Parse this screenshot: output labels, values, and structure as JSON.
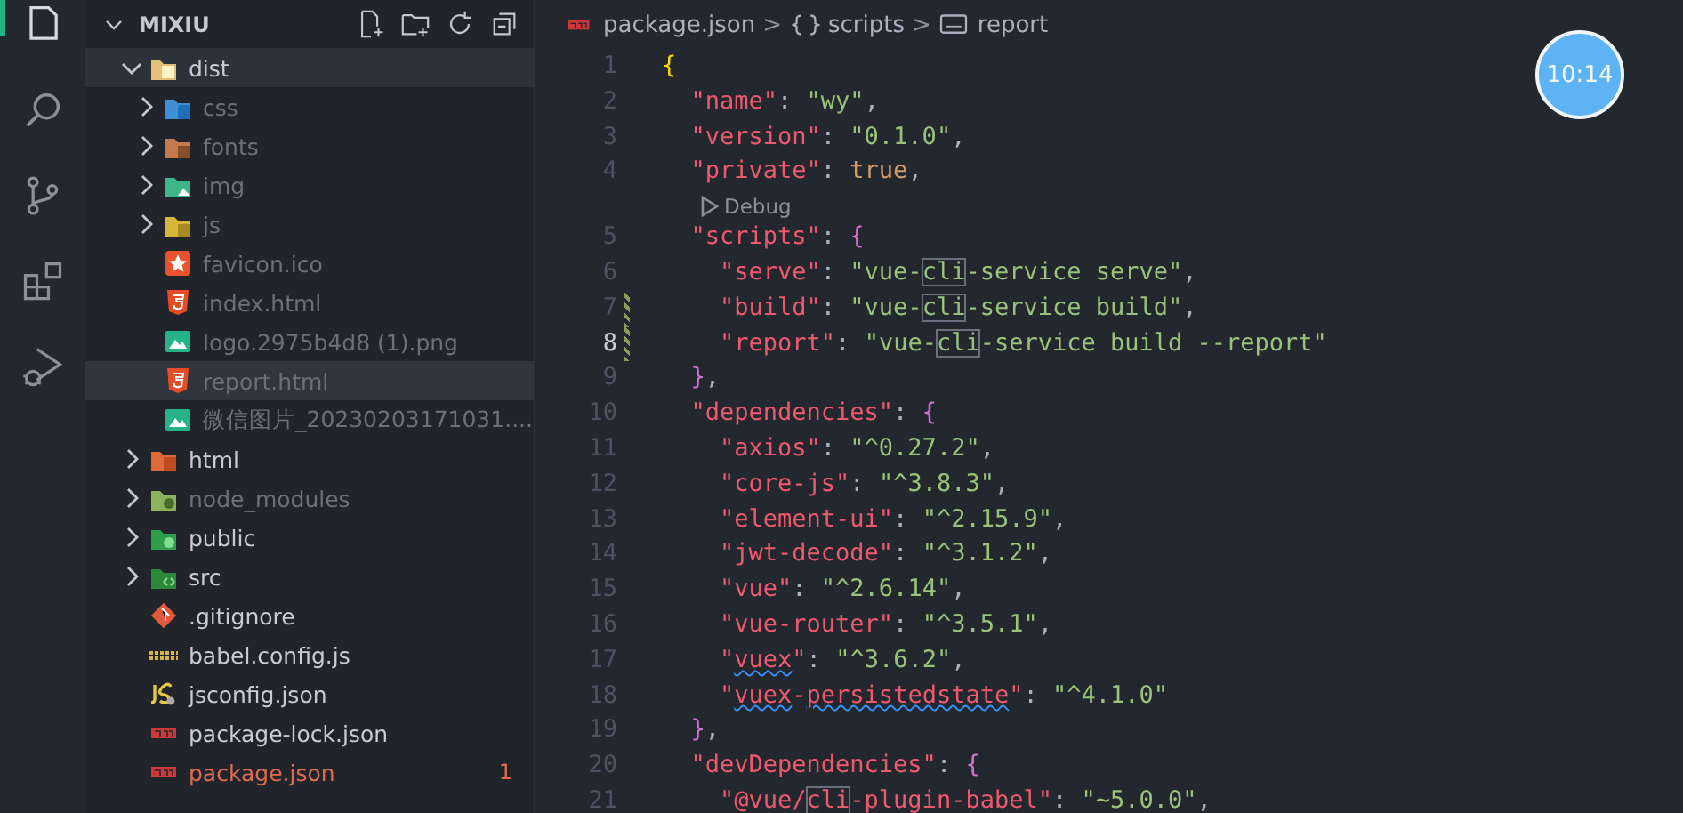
{
  "activity_bar": {
    "items": [
      {
        "kind": "explorer",
        "selected": true
      },
      {
        "kind": "search",
        "selected": false
      },
      {
        "kind": "source-control",
        "selected": false
      },
      {
        "kind": "extensions",
        "selected": false
      },
      {
        "kind": "run-debug",
        "selected": false
      }
    ]
  },
  "explorer": {
    "title": "MIXIU",
    "tree": [
      {
        "name": "dist",
        "kind": "dist-folder",
        "expanded": true,
        "selected": true,
        "hovered": false,
        "ignored": false,
        "children": [
          {
            "name": "css",
            "kind": "css-folder",
            "expanded": false,
            "selected": false,
            "hovered": false,
            "ignored": true
          },
          {
            "name": "fonts",
            "kind": "fonts-folder",
            "expanded": false,
            "selected": false,
            "hovered": false,
            "ignored": true
          },
          {
            "name": "img",
            "kind": "img-folder",
            "expanded": false,
            "selected": false,
            "hovered": false,
            "ignored": true
          },
          {
            "name": "js",
            "kind": "js-folder",
            "expanded": false,
            "selected": false,
            "hovered": false,
            "ignored": true
          },
          {
            "name": "favicon.ico",
            "kind": "favicon",
            "selected": false,
            "hovered": false,
            "ignored": true
          },
          {
            "name": "index.html",
            "kind": "html",
            "selected": false,
            "hovered": false,
            "ignored": true
          },
          {
            "name": "logo.2975b4d8 (1).png",
            "kind": "image",
            "selected": false,
            "hovered": false,
            "ignored": true
          },
          {
            "name": "report.html",
            "kind": "html",
            "selected": false,
            "hovered": true,
            "ignored": true
          },
          {
            "name": "微信图片_20230203171031....",
            "kind": "image",
            "selected": false,
            "hovered": false,
            "ignored": true
          }
        ]
      },
      {
        "name": "html",
        "kind": "html-folder",
        "expanded": false,
        "selected": false,
        "hovered": false,
        "ignored": false
      },
      {
        "name": "node_modules",
        "kind": "node-folder",
        "expanded": false,
        "selected": false,
        "hovered": false,
        "ignored": true
      },
      {
        "name": "public",
        "kind": "public-folder",
        "expanded": false,
        "selected": false,
        "hovered": false,
        "ignored": false
      },
      {
        "name": "src",
        "kind": "src-folder",
        "expanded": false,
        "selected": false,
        "hovered": false,
        "ignored": false
      },
      {
        "name": ".gitignore",
        "kind": "git",
        "selected": false,
        "hovered": false,
        "ignored": false
      },
      {
        "name": "babel.config.js",
        "kind": "babel",
        "selected": false,
        "hovered": false,
        "ignored": false
      },
      {
        "name": "jsconfig.json",
        "kind": "jsconfig",
        "selected": false,
        "hovered": false,
        "ignored": false
      },
      {
        "name": "package-lock.json",
        "kind": "npm",
        "selected": false,
        "hovered": false,
        "ignored": false
      },
      {
        "name": "package.json",
        "kind": "npm",
        "selected": false,
        "hovered": false,
        "ignored": false,
        "problems": "1"
      }
    ]
  },
  "breadcrumb": [
    {
      "text": "package.json",
      "kind": "npm"
    },
    {
      "text": ">",
      "kind": "separator"
    },
    {
      "text": "scripts",
      "kind": "braces"
    },
    {
      "text": ">",
      "kind": "separator"
    },
    {
      "text": "report",
      "kind": "string"
    }
  ],
  "editor": {
    "lines": [
      {
        "kind": "code",
        "number": "1",
        "current": false,
        "modified": false,
        "tokens": [
          {
            "text": "{",
            "kind": "brace1"
          }
        ]
      },
      {
        "kind": "code",
        "number": "2",
        "current": false,
        "modified": false,
        "tokens": [
          {
            "text": "  \"name\"",
            "kind": "key"
          },
          {
            "text": ": ",
            "kind": "punct"
          },
          {
            "text": "\"wy\"",
            "kind": "str"
          },
          {
            "text": ",",
            "kind": "punct"
          }
        ]
      },
      {
        "kind": "code",
        "number": "3",
        "current": false,
        "modified": false,
        "tokens": [
          {
            "text": "  \"version\"",
            "kind": "key"
          },
          {
            "text": ": ",
            "kind": "punct"
          },
          {
            "text": "\"0.1.0\"",
            "kind": "str"
          },
          {
            "text": ",",
            "kind": "punct"
          }
        ]
      },
      {
        "kind": "code",
        "number": "4",
        "current": false,
        "modified": false,
        "tokens": [
          {
            "text": "  \"private\"",
            "kind": "key"
          },
          {
            "text": ": ",
            "kind": "punct"
          },
          {
            "text": "true",
            "kind": "bool"
          },
          {
            "text": ",",
            "kind": "punct"
          }
        ]
      },
      {
        "kind": "codelens",
        "text": "Debug"
      },
      {
        "kind": "code",
        "number": "5",
        "current": false,
        "modified": false,
        "tokens": [
          {
            "text": "  \"scripts\"",
            "kind": "key"
          },
          {
            "text": ": ",
            "kind": "punct"
          },
          {
            "text": "{",
            "kind": "brace2"
          }
        ]
      },
      {
        "kind": "code",
        "number": "6",
        "current": false,
        "modified": false,
        "tokens": [
          {
            "text": "    \"serve\"",
            "kind": "key"
          },
          {
            "text": ": ",
            "kind": "punct"
          },
          {
            "text": "\"vue-",
            "kind": "str"
          },
          {
            "text": "cli",
            "kind": "str",
            "boxed": true
          },
          {
            "text": "-service serve\"",
            "kind": "str"
          },
          {
            "text": ",",
            "kind": "punct"
          }
        ]
      },
      {
        "kind": "code",
        "number": "7",
        "current": false,
        "modified": true,
        "tokens": [
          {
            "text": "    \"build\"",
            "kind": "key"
          },
          {
            "text": ": ",
            "kind": "punct"
          },
          {
            "text": "\"vue-",
            "kind": "str"
          },
          {
            "text": "cli",
            "kind": "str",
            "boxed": true
          },
          {
            "text": "-service build\"",
            "kind": "str"
          },
          {
            "text": ",",
            "kind": "punct"
          }
        ]
      },
      {
        "kind": "code",
        "number": "8",
        "current": true,
        "modified": true,
        "tokens": [
          {
            "text": "    \"report\"",
            "kind": "key"
          },
          {
            "text": ": ",
            "kind": "punct"
          },
          {
            "text": "\"vue-",
            "kind": "str"
          },
          {
            "text": "cli",
            "kind": "str",
            "boxed": true
          },
          {
            "text": "-service build --report\"",
            "kind": "str"
          }
        ]
      },
      {
        "kind": "code",
        "number": "9",
        "current": false,
        "modified": false,
        "tokens": [
          {
            "text": "  }",
            "kind": "brace2"
          },
          {
            "text": ",",
            "kind": "punct"
          }
        ]
      },
      {
        "kind": "code",
        "number": "10",
        "current": false,
        "modified": false,
        "tokens": [
          {
            "text": "  \"dependencies\"",
            "kind": "key"
          },
          {
            "text": ": ",
            "kind": "punct"
          },
          {
            "text": "{",
            "kind": "brace2"
          }
        ]
      },
      {
        "kind": "code",
        "number": "11",
        "current": false,
        "modified": false,
        "tokens": [
          {
            "text": "    \"axios\"",
            "kind": "key"
          },
          {
            "text": ": ",
            "kind": "punct"
          },
          {
            "text": "\"^0.27.2\"",
            "kind": "str"
          },
          {
            "text": ",",
            "kind": "punct"
          }
        ]
      },
      {
        "kind": "code",
        "number": "12",
        "current": false,
        "modified": false,
        "tokens": [
          {
            "text": "    \"core-js\"",
            "kind": "key"
          },
          {
            "text": ": ",
            "kind": "punct"
          },
          {
            "text": "\"^3.8.3\"",
            "kind": "str"
          },
          {
            "text": ",",
            "kind": "punct"
          }
        ]
      },
      {
        "kind": "code",
        "number": "13",
        "current": false,
        "modified": false,
        "tokens": [
          {
            "text": "    \"element-ui\"",
            "kind": "key"
          },
          {
            "text": ": ",
            "kind": "punct"
          },
          {
            "text": "\"^2.15.9\"",
            "kind": "str"
          },
          {
            "text": ",",
            "kind": "punct"
          }
        ]
      },
      {
        "kind": "code",
        "number": "14",
        "current": false,
        "modified": false,
        "tokens": [
          {
            "text": "    \"jwt-decode\"",
            "kind": "key"
          },
          {
            "text": ": ",
            "kind": "punct"
          },
          {
            "text": "\"^3.1.2\"",
            "kind": "str"
          },
          {
            "text": ",",
            "kind": "punct"
          }
        ]
      },
      {
        "kind": "code",
        "number": "15",
        "current": false,
        "modified": false,
        "tokens": [
          {
            "text": "    \"vue\"",
            "kind": "key"
          },
          {
            "text": ": ",
            "kind": "punct"
          },
          {
            "text": "\"^2.6.14\"",
            "kind": "str"
          },
          {
            "text": ",",
            "kind": "punct"
          }
        ]
      },
      {
        "kind": "code",
        "number": "16",
        "current": false,
        "modified": false,
        "tokens": [
          {
            "text": "    \"vue-router\"",
            "kind": "key"
          },
          {
            "text": ": ",
            "kind": "punct"
          },
          {
            "text": "\"^3.5.1\"",
            "kind": "str"
          },
          {
            "text": ",",
            "kind": "punct"
          }
        ]
      },
      {
        "kind": "code",
        "number": "17",
        "current": false,
        "modified": false,
        "tokens": [
          {
            "text": "    \"",
            "kind": "key"
          },
          {
            "text": "vuex",
            "kind": "key",
            "squiggle": true
          },
          {
            "text": "\"",
            "kind": "key"
          },
          {
            "text": ": ",
            "kind": "punct"
          },
          {
            "text": "\"^3.6.2\"",
            "kind": "str"
          },
          {
            "text": ",",
            "kind": "punct"
          }
        ]
      },
      {
        "kind": "code",
        "number": "18",
        "current": false,
        "modified": false,
        "tokens": [
          {
            "text": "    \"",
            "kind": "key"
          },
          {
            "text": "vuex",
            "kind": "key",
            "squiggle": true
          },
          {
            "text": "-",
            "kind": "key"
          },
          {
            "text": "persistedstate",
            "kind": "key",
            "squiggle": true
          },
          {
            "text": "\"",
            "kind": "key"
          },
          {
            "text": ": ",
            "kind": "punct"
          },
          {
            "text": "\"^4.1.0\"",
            "kind": "str"
          }
        ]
      },
      {
        "kind": "code",
        "number": "19",
        "current": false,
        "modified": false,
        "tokens": [
          {
            "text": "  }",
            "kind": "brace2"
          },
          {
            "text": ",",
            "kind": "punct"
          }
        ]
      },
      {
        "kind": "code",
        "number": "20",
        "current": false,
        "modified": false,
        "tokens": [
          {
            "text": "  \"devDependencies\"",
            "kind": "key"
          },
          {
            "text": ": ",
            "kind": "punct"
          },
          {
            "text": "{",
            "kind": "brace2"
          }
        ]
      },
      {
        "kind": "code",
        "number": "21",
        "current": false,
        "modified": false,
        "tokens": [
          {
            "text": "    \"@vue/",
            "kind": "key"
          },
          {
            "text": "cli",
            "kind": "key",
            "boxed": true
          },
          {
            "text": "-plugin-babel\"",
            "kind": "key"
          },
          {
            "text": ": ",
            "kind": "punct"
          },
          {
            "text": "\"~5.0.0\"",
            "kind": "str"
          },
          {
            "text": ",",
            "kind": "punct"
          }
        ]
      }
    ]
  },
  "clock": {
    "time": "10:14"
  }
}
